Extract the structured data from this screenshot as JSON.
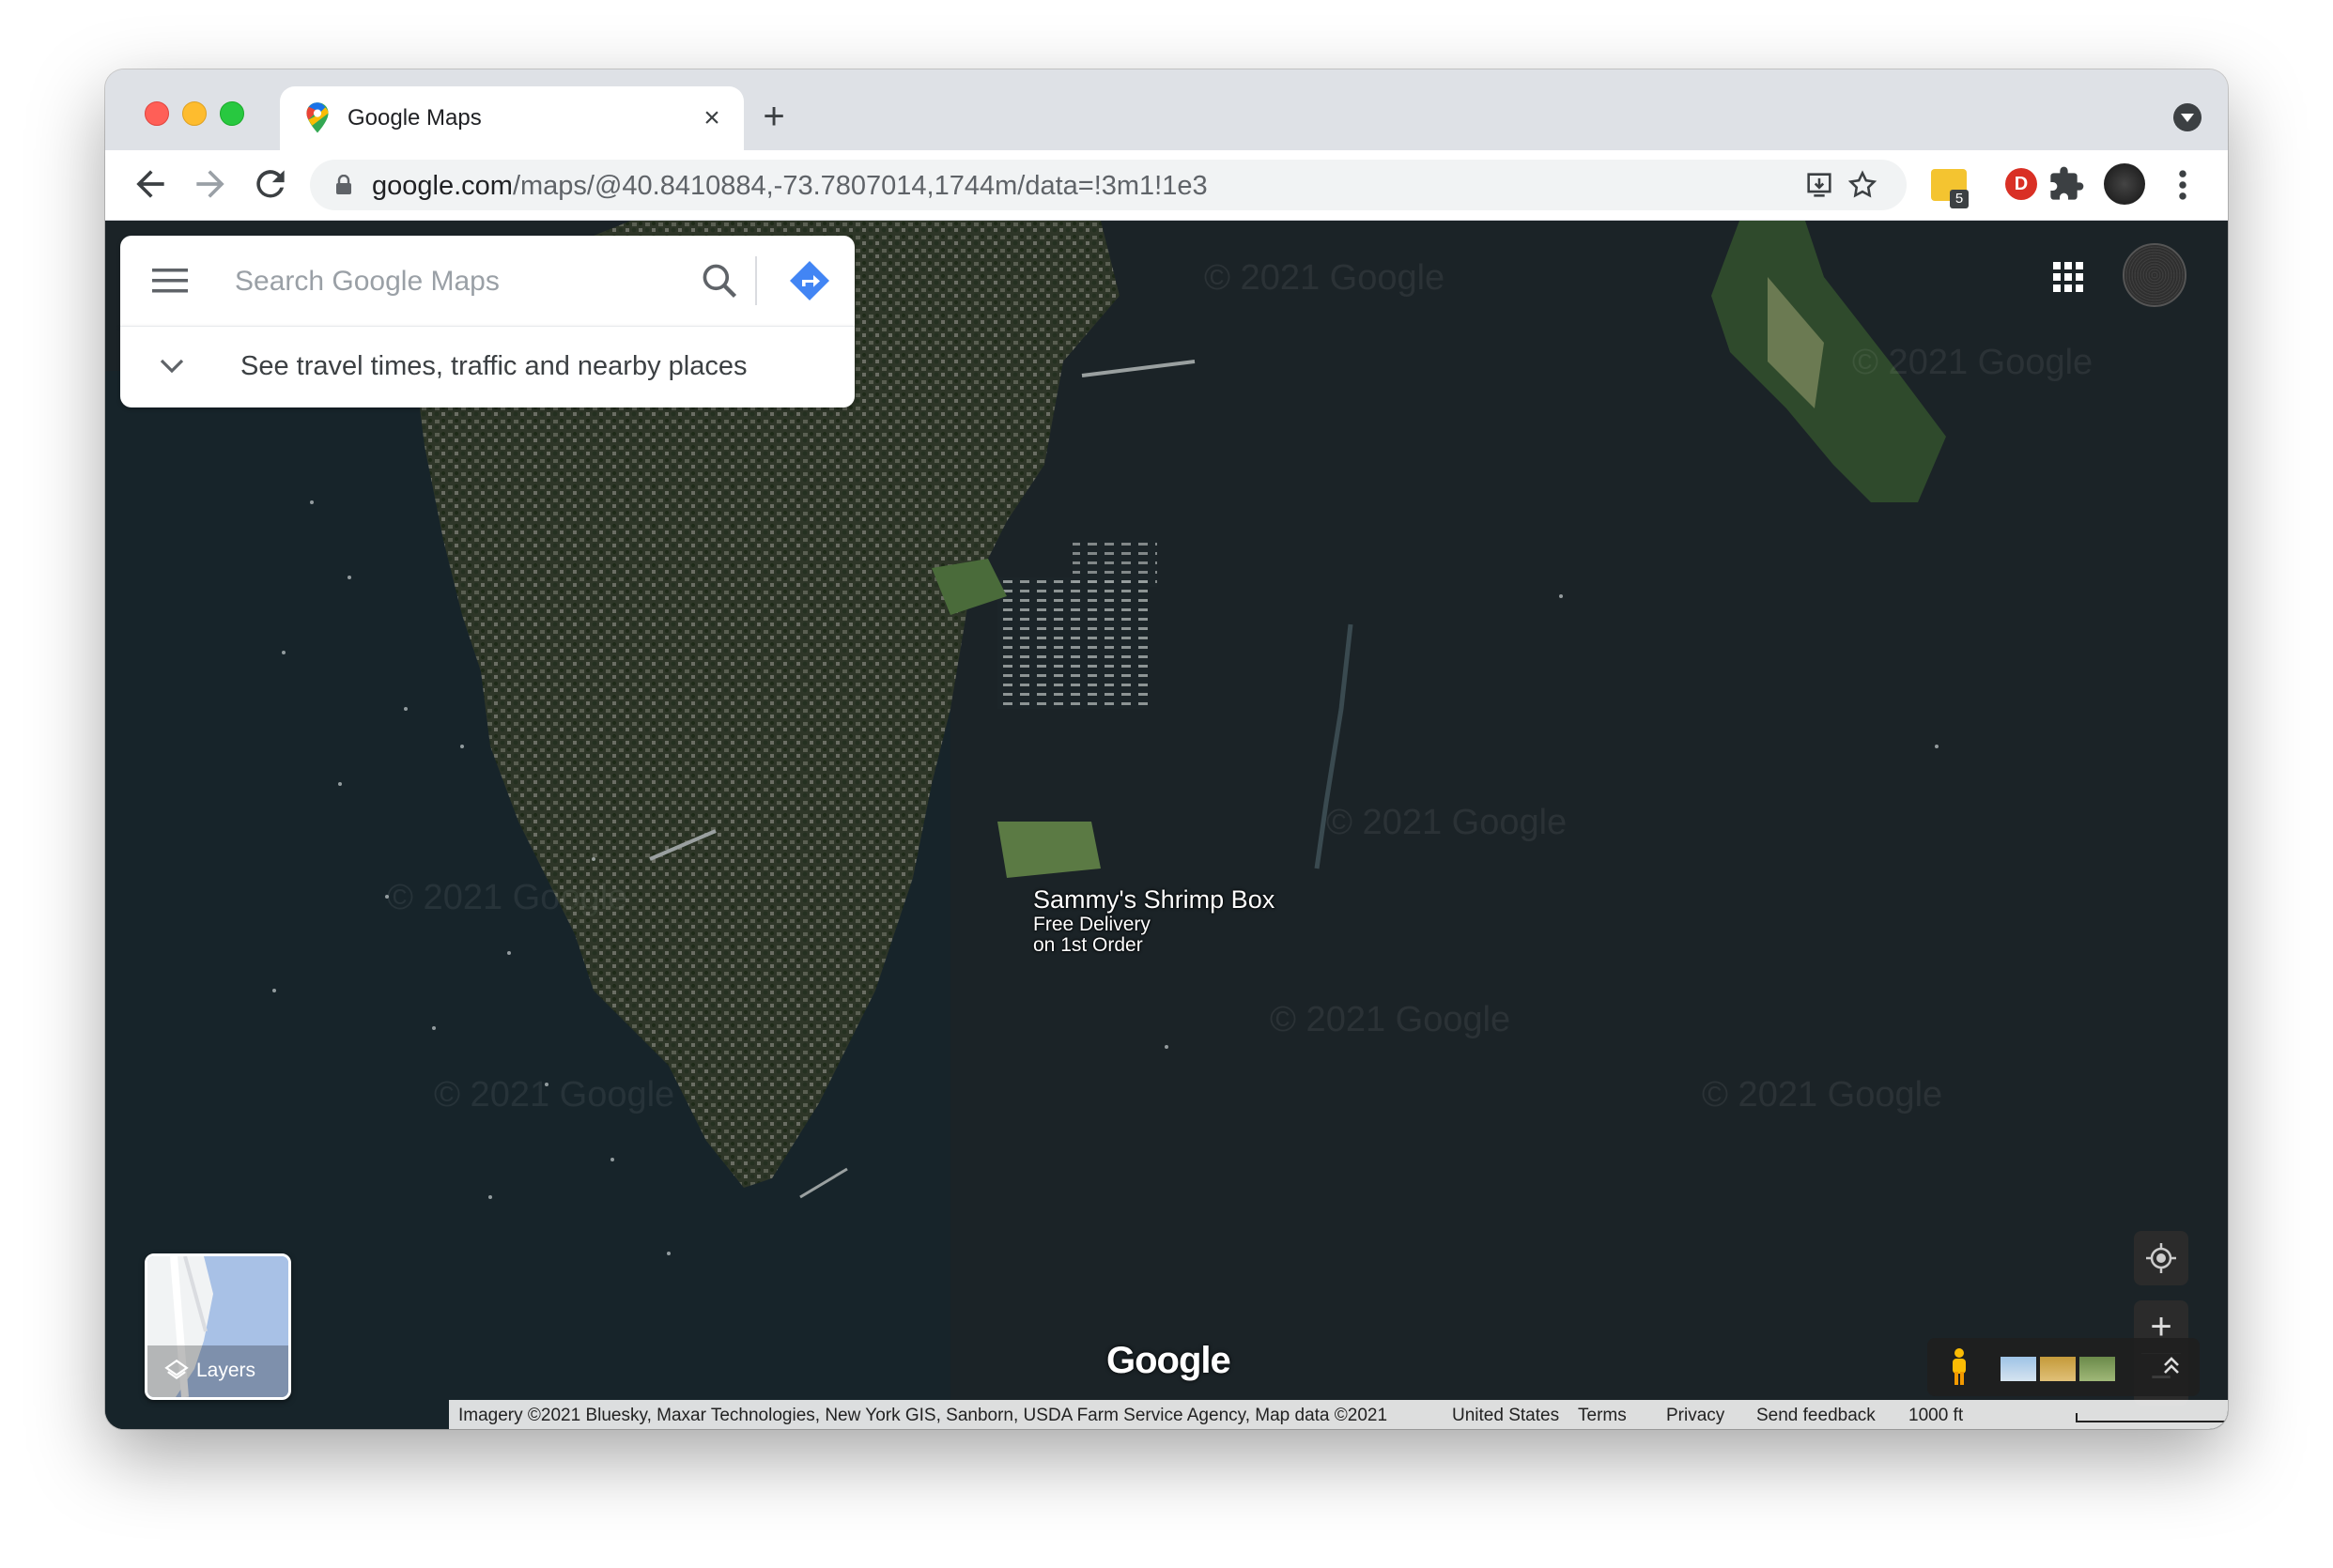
{
  "browser": {
    "tab_title": "Google Maps",
    "url_host": "google.com",
    "url_path": "/maps/@40.8410884,-73.7807014,1744m/data=!3m1!1e3",
    "extension_badge_count": "5",
    "extension_letter": "D"
  },
  "search": {
    "placeholder": "Search Google Maps",
    "travel_prompt": "See travel times, traffic and nearby places"
  },
  "map": {
    "place": {
      "name": "Sammy's Shrimp Box",
      "line1": "Free Delivery",
      "line2": "on 1st Order"
    },
    "watermark": "© 2021 Google",
    "layers_label": "Layers",
    "logo_text": "Google"
  },
  "footer": {
    "imagery": "Imagery ©2021 Bluesky, Maxar Technologies, New York GIS, Sanborn, USDA Farm Service Agency, Map data ©2021",
    "country": "United States",
    "terms": "Terms",
    "privacy": "Privacy",
    "feedback": "Send feedback",
    "scale": "1000 ft"
  },
  "colors": {
    "water": "#1a2226",
    "brand_blue": "#4285f4"
  }
}
